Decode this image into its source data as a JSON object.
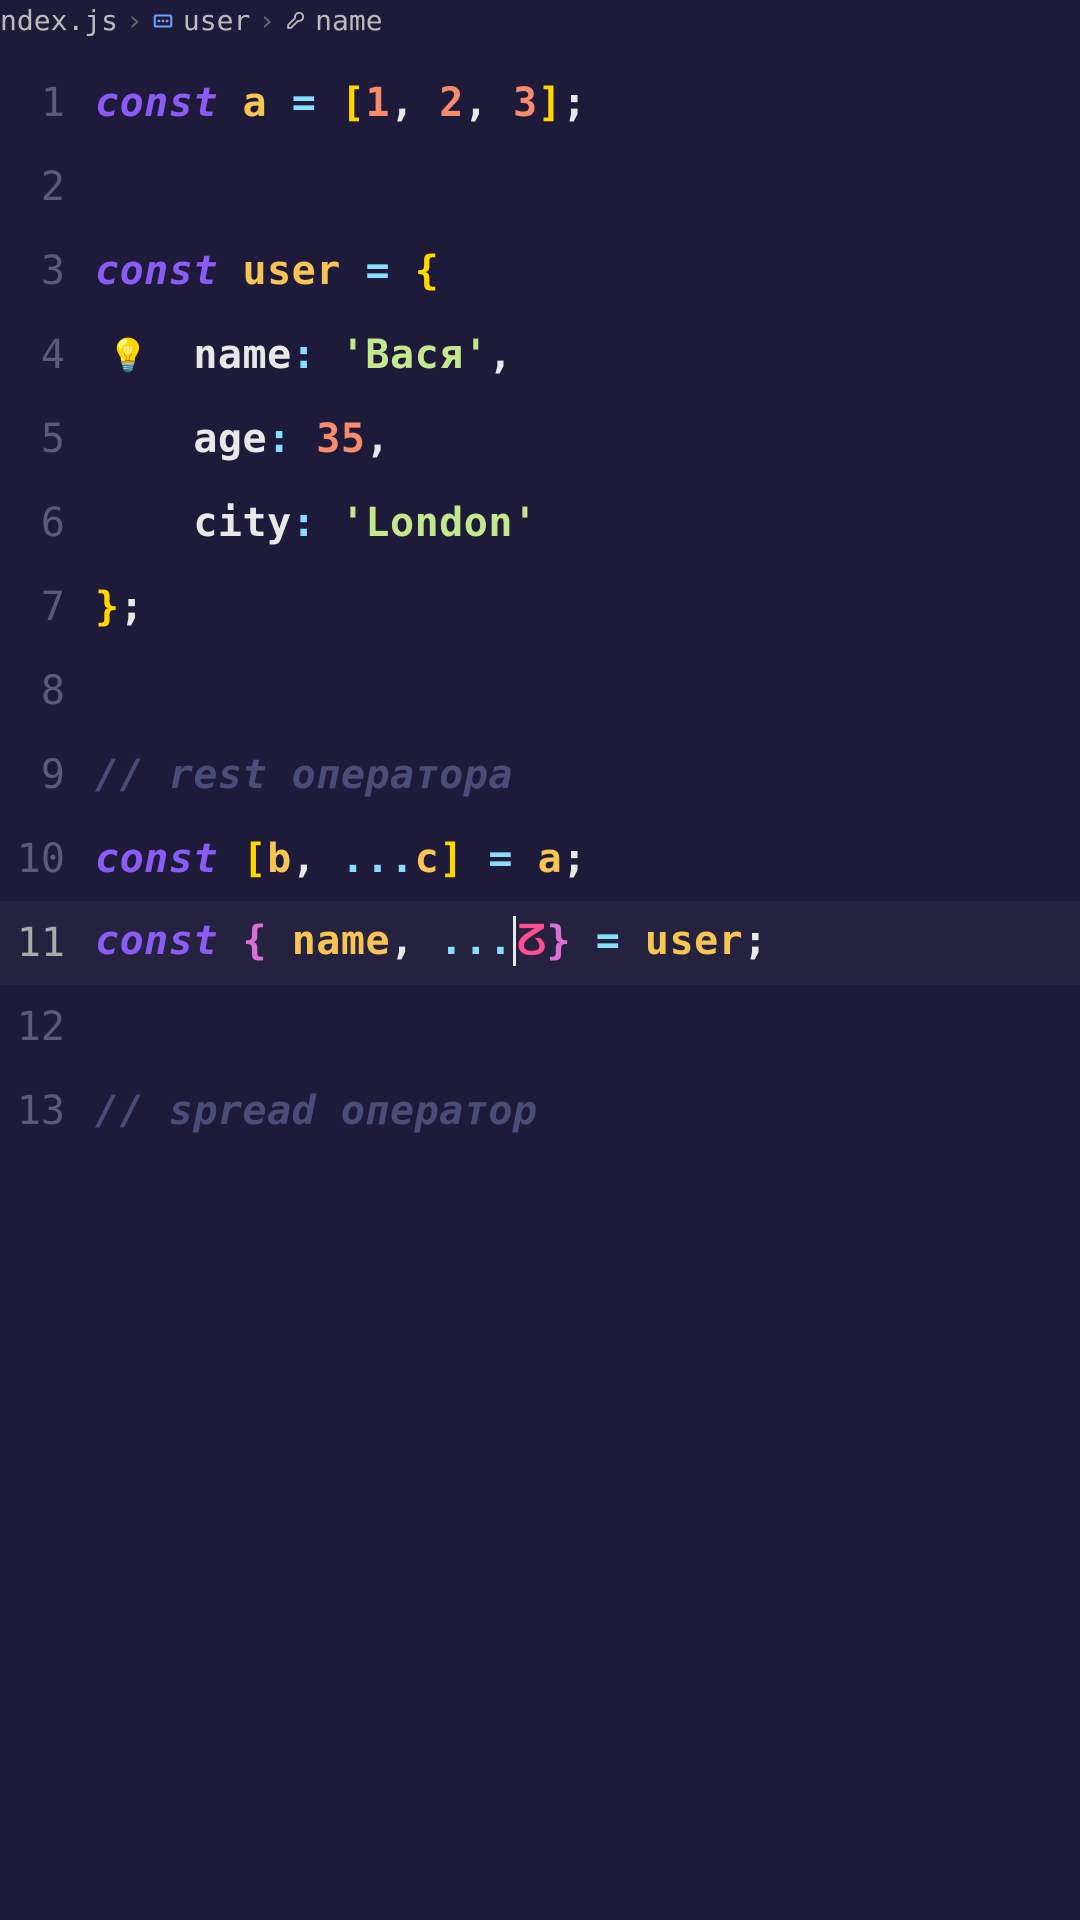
{
  "breadcrumb": {
    "file": "ndex.js",
    "symbol1": "user",
    "symbol2": "name"
  },
  "gutter": [
    "1",
    "2",
    "3",
    "4",
    "5",
    "6",
    "7",
    "8",
    "9",
    "10",
    "11",
    "12",
    "13"
  ],
  "tokens": {
    "const": "const",
    "a": "a",
    "eq": "=",
    "lbrack": "[",
    "rbrack": "]",
    "n1": "1",
    "n2": "2",
    "n3": "3",
    "semi": ";",
    "comma": ",",
    "user": "user",
    "lbrace": "{",
    "rbrace": "}",
    "name": "name",
    "colon": ":",
    "str_vasya": "'Вася'",
    "age": "age",
    "n35": "35",
    "city": "city",
    "str_london": "'London'",
    "comment_rest": "// rest оператора",
    "b": "b",
    "spread": "...",
    "c": "c",
    "comment_spread": "// spread оператор"
  },
  "bulb_line": 4,
  "active_line": 11,
  "cursor_glyph": "ⵒ"
}
